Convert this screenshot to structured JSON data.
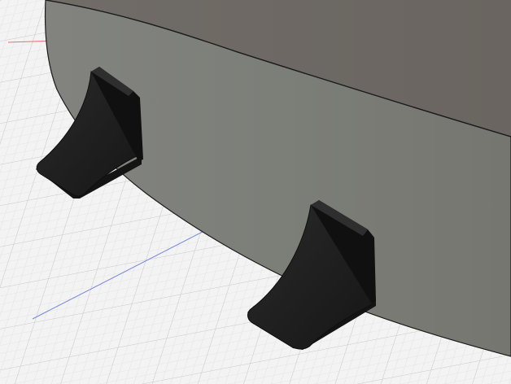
{
  "viewport": {
    "background_color": "#f3f3f3",
    "grid_minor_color": "#dcdcdc",
    "grid_major_color": "#c8c8c8",
    "axis_x_color": "#6f7fe0",
    "axis_y_color": "#e07070"
  },
  "model": {
    "wall_front_color": "#7f807b",
    "wall_top_color": "#6f6b66",
    "edge_color": "#1e1e1e",
    "support_color": "#202020",
    "support_shadow_color": "#121212",
    "support_highlight_color": "#3a3a3a",
    "supports": [
      {
        "name": "left-support"
      },
      {
        "name": "right-support"
      }
    ]
  },
  "icons": {
    "wall": "curved-wall-body",
    "support": "bracket-foot-icon"
  }
}
